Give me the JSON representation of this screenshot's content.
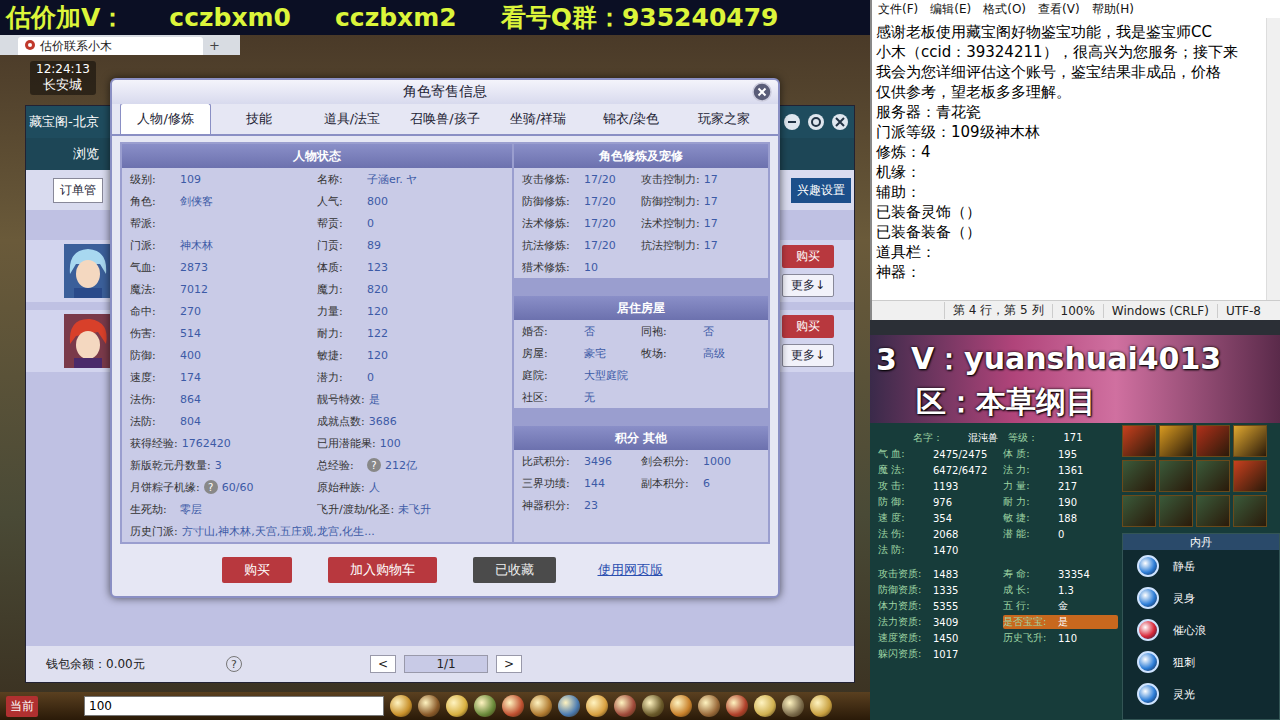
{
  "banner": {
    "parts": [
      "估价加V：",
      "cczbxm0",
      "cczbxm2",
      "看号Q群：935240479"
    ]
  },
  "browser": {
    "tab": "估价联系小木",
    "new_tab": "+"
  },
  "game": {
    "time": "12:24:13",
    "location": "长安城"
  },
  "market": {
    "title": "藏宝阁-北京",
    "nav": "浏览",
    "orders": "订单管",
    "interest": "兴趣设置",
    "listings": [
      {
        "buy": "购买",
        "more": "更多↓"
      },
      {
        "buy": "购买",
        "more": "更多↓"
      }
    ],
    "wallet": "钱包余额：0.00元",
    "help": "?",
    "pager": {
      "prev": "<",
      "page": "1/1",
      "next": ">"
    }
  },
  "chat": {
    "channel": "当前",
    "input": "100"
  },
  "dialog": {
    "title": "角色寄售信息",
    "tabs": [
      {
        "label": "人物/修炼",
        "selected": true
      },
      {
        "label": "技能",
        "selected": false
      },
      {
        "label": "道具/法宝",
        "selected": false
      },
      {
        "label": "召唤兽/孩子",
        "selected": false
      },
      {
        "label": "坐骑/祥瑞",
        "selected": false
      },
      {
        "label": "锦衣/染色",
        "selected": false
      },
      {
        "label": "玩家之家",
        "selected": false
      }
    ],
    "status_panel": {
      "title": "人物状态",
      "rows": [
        [
          {
            "label": "级别:",
            "value": "109"
          },
          {
            "label": "名称:",
            "value": "子涵er. ヤ"
          }
        ],
        [
          {
            "label": "角色:",
            "value": "剑侠客"
          },
          {
            "label": "人气:",
            "value": "800"
          }
        ],
        [
          {
            "label": "帮派:",
            "value": ""
          },
          {
            "label": "帮贡:",
            "value": "0"
          }
        ],
        [
          {
            "label": "门派:",
            "value": "神木林"
          },
          {
            "label": "门贡:",
            "value": "89"
          }
        ],
        [
          {
            "label": "气血:",
            "value": "2873"
          },
          {
            "label": "体质:",
            "value": "123"
          }
        ],
        [
          {
            "label": "魔法:",
            "value": "7012"
          },
          {
            "label": "魔力:",
            "value": "820"
          }
        ],
        [
          {
            "label": "命中:",
            "value": "270"
          },
          {
            "label": "力量:",
            "value": "120"
          }
        ],
        [
          {
            "label": "伤害:",
            "value": "514"
          },
          {
            "label": "耐力:",
            "value": "122"
          }
        ],
        [
          {
            "label": "防御:",
            "value": "400"
          },
          {
            "label": "敏捷:",
            "value": "120"
          }
        ],
        [
          {
            "label": "速度:",
            "value": "174"
          },
          {
            "label": "潜力:",
            "value": "0"
          }
        ],
        [
          {
            "label": "法伤:",
            "value": "864"
          },
          {
            "label": "靓号特效:",
            "value": "是"
          }
        ],
        [
          {
            "label": "法防:",
            "value": "804"
          },
          {
            "label": "成就点数:",
            "value": "3686"
          }
        ],
        [
          {
            "label": "获得经验:",
            "value": "1762420"
          },
          {
            "label": "已用潜能果:",
            "value": "100"
          }
        ],
        [
          {
            "label": "新版乾元丹数量:",
            "value": "3"
          },
          {
            "label": "总经验:",
            "help": "?",
            "value": "212亿"
          }
        ],
        [
          {
            "label": "月饼粽子机缘:",
            "help": "?",
            "value": "60/60"
          },
          {
            "label": "原始种族:",
            "value": "人"
          }
        ],
        [
          {
            "label": "生死劫:",
            "value": "零层"
          },
          {
            "label": "飞升/渡劫/化圣:",
            "value": "未飞升"
          }
        ]
      ],
      "history": {
        "label": "历史门派:",
        "value": "方寸山,神木林,天宫,五庄观,龙宫,化生..."
      }
    },
    "cultivation": {
      "title": "角色修炼及宠修",
      "rows": [
        [
          {
            "label": "攻击修炼:",
            "value": "17/20"
          },
          {
            "label": "攻击控制力:",
            "value": "17"
          }
        ],
        [
          {
            "label": "防御修炼:",
            "value": "17/20"
          },
          {
            "label": "防御控制力:",
            "value": "17"
          }
        ],
        [
          {
            "label": "法术修炼:",
            "value": "17/20"
          },
          {
            "label": "法术控制力:",
            "value": "17"
          }
        ],
        [
          {
            "label": "抗法修炼:",
            "value": "17/20"
          },
          {
            "label": "抗法控制力:",
            "value": "17"
          }
        ],
        [
          {
            "label": "猎术修炼:",
            "value": "10"
          }
        ]
      ]
    },
    "house": {
      "title": "居住房屋",
      "rows": [
        [
          {
            "label": "婚否:",
            "value": "否"
          },
          {
            "label": "同袍:",
            "value": "否"
          }
        ],
        [
          {
            "label": "房屋:",
            "value": "豪宅"
          },
          {
            "label": "牧场:",
            "value": "高级"
          }
        ],
        [
          {
            "label": "庭院:",
            "value": "大型庭院"
          }
        ],
        [
          {
            "label": "社区:",
            "value": "无"
          }
        ]
      ]
    },
    "points": {
      "title": "积分 其他",
      "rows": [
        [
          {
            "label": "比武积分:",
            "value": "3496"
          },
          {
            "label": "剑会积分:",
            "value": "1000"
          }
        ],
        [
          {
            "label": "三界功绩:",
            "value": "144"
          },
          {
            "label": "副本积分:",
            "value": "6"
          }
        ],
        [
          {
            "label": "神器积分:",
            "value": "23"
          }
        ]
      ]
    },
    "buttons": [
      {
        "label": "购买",
        "kind": "primary"
      },
      {
        "label": "加入购物车",
        "kind": "primary"
      },
      {
        "label": "已收藏",
        "kind": "disabled"
      },
      {
        "label": "使用网页版",
        "kind": "link"
      }
    ]
  },
  "notepad": {
    "menu": [
      "文件(F)",
      "编辑(E)",
      "格式(O)",
      "查看(V)",
      "帮助(H)"
    ],
    "lines": [
      "感谢老板使用藏宝阁好物鉴宝功能，我是鉴宝师CC",
      "小木（ccid：39324211），很高兴为您服务；接下来",
      "我会为您详细评估这个账号，鉴宝结果非成品，价格",
      "仅供参考，望老板多多理解。",
      "服务器：青花瓷",
      "门派等级：109级神木林",
      "修炼：4",
      "机缘：",
      "辅助：",
      "已装备灵饰（）",
      "已装备装备（）",
      "道具栏：",
      "神器："
    ],
    "status": [
      "第 4 行，第 5 列",
      "100%",
      "Windows (CRLF)",
      "UTF-8"
    ]
  },
  "pet": {
    "header": [
      "3",
      "V：yuanshuai4013",
      "区：本草纲目"
    ],
    "name": {
      "label": "名字：",
      "value": "混沌兽"
    },
    "level": {
      "label": "等级：",
      "value": "171"
    },
    "stats": [
      [
        {
          "label": "气 血:",
          "value": "2475/2475"
        },
        {
          "label": "体 质:",
          "value": "195"
        }
      ],
      [
        {
          "label": "魔 法:",
          "value": "6472/6472"
        },
        {
          "label": "法 力:",
          "value": "1361"
        }
      ],
      [
        {
          "label": "攻 击:",
          "value": "1193"
        },
        {
          "label": "力 量:",
          "value": "217"
        }
      ],
      [
        {
          "label": "防 御:",
          "value": "976"
        },
        {
          "label": "耐 力:",
          "value": "190"
        }
      ],
      [
        {
          "label": "速 度:",
          "value": "354"
        },
        {
          "label": "敏 捷:",
          "value": "188"
        }
      ],
      [
        {
          "label": "法 伤:",
          "value": "2068"
        },
        {
          "label": "潜 能:",
          "value": "0"
        }
      ],
      [
        {
          "label": "法 防:",
          "value": "1470"
        }
      ]
    ],
    "aptitudes": [
      [
        {
          "label": "攻击资质:",
          "value": "1483",
          "highlighted": false
        },
        {
          "label": "寿 命:",
          "value": "33354",
          "highlighted": false
        }
      ],
      [
        {
          "label": "防御资质:",
          "value": "1335",
          "highlighted": false
        },
        {
          "label": "成 长:",
          "value": "1.3",
          "highlighted": false
        }
      ],
      [
        {
          "label": "体力资质:",
          "value": "5355",
          "highlighted": false
        },
        {
          "label": "五 行:",
          "value": "金",
          "highlighted": false
        }
      ],
      [
        {
          "label": "法力资质:",
          "value": "3409",
          "highlighted": false
        },
        {
          "label": "是否宝宝:",
          "value": "是",
          "highlighted": true
        }
      ],
      [
        {
          "label": "速度资质:",
          "value": "1450",
          "highlighted": false
        },
        {
          "label": "历史飞升:",
          "value": "110",
          "highlighted": false
        }
      ],
      [
        {
          "label": "躲闪资质:",
          "value": "1017",
          "highlighted": false
        }
      ]
    ],
    "neidan": {
      "title": "内丹",
      "items": [
        {
          "name": "静岳",
          "color": "#2f7fd8"
        },
        {
          "name": "灵身",
          "color": "#2f7fd8"
        },
        {
          "name": "催心浪",
          "color": "#d8283a"
        },
        {
          "name": "狙刺",
          "color": "#2f7fd8"
        },
        {
          "name": "灵光",
          "color": "#2f7fd8"
        }
      ]
    }
  }
}
